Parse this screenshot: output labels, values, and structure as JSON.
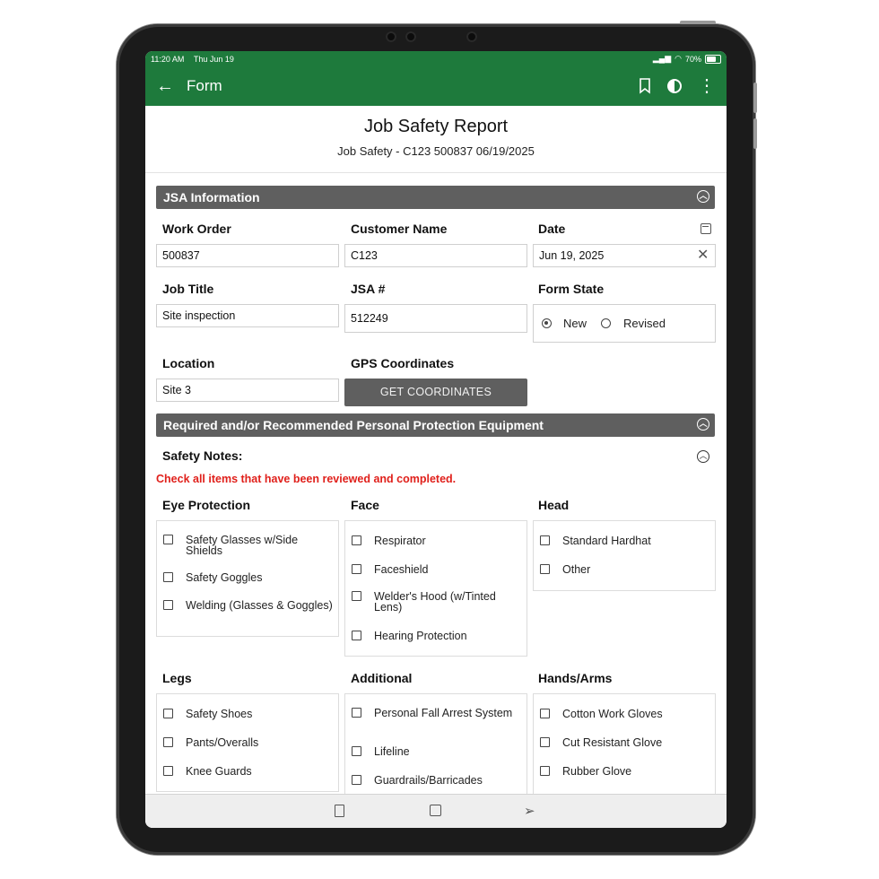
{
  "status": {
    "time": "11:20 AM",
    "date": "Thu Jun 19",
    "battery": "70%"
  },
  "appbar": {
    "title": "Form"
  },
  "report": {
    "title": "Job Safety Report",
    "subtitle": "Job Safety - C123 500837 06/19/2025"
  },
  "jsa": {
    "header": "JSA Information",
    "work_order_label": "Work Order",
    "work_order": "500837",
    "customer_label": "Customer Name",
    "customer": "C123",
    "date_label": "Date",
    "date": "Jun 19, 2025",
    "job_title_label": "Job Title",
    "job_title": "Site inspection",
    "jsa_no_label": "JSA #",
    "jsa_no": "512249",
    "form_state_label": "Form State",
    "state_new": "New",
    "state_revised": "Revised",
    "location_label": "Location",
    "location": "Site 3",
    "gps_label": "GPS Coordinates",
    "gps_button": "GET COORDINATES"
  },
  "ppe": {
    "header": "Required and/or Recommended Personal Protection Equipment",
    "notes_label": "Safety Notes:",
    "warning": "Check all items that have been reviewed and completed.",
    "groups": {
      "eye": {
        "title": "Eye Protection",
        "items": [
          "Safety Glasses w/Side Shields",
          "Safety Goggles",
          "Welding (Glasses & Goggles)"
        ]
      },
      "face": {
        "title": "Face",
        "items": [
          "Respirator",
          "Faceshield",
          "Welder's Hood (w/Tinted Lens)",
          "Hearing Protection"
        ]
      },
      "head": {
        "title": "Head",
        "items": [
          "Standard Hardhat",
          "Other"
        ]
      },
      "legs": {
        "title": "Legs",
        "items": [
          "Safety Shoes",
          "Pants/Overalls",
          "Knee Guards"
        ]
      },
      "additional": {
        "title": "Additional",
        "items": [
          "Personal Fall Arrest System",
          "Lifeline",
          "Guardrails/Barricades"
        ]
      },
      "hands": {
        "title": "Hands/Arms",
        "items": [
          "Cotton Work Gloves",
          "Cut Resistant Glove",
          "Rubber Glove"
        ]
      }
    }
  },
  "icons": {
    "back": "arrow-left-icon",
    "bookmark": "bookmark-icon",
    "contrast": "contrast-icon",
    "more": "kebab-icon"
  },
  "colors": {
    "appbar": "#1e7a3c",
    "section": "#5f5f5f",
    "warning": "#e0201b"
  }
}
